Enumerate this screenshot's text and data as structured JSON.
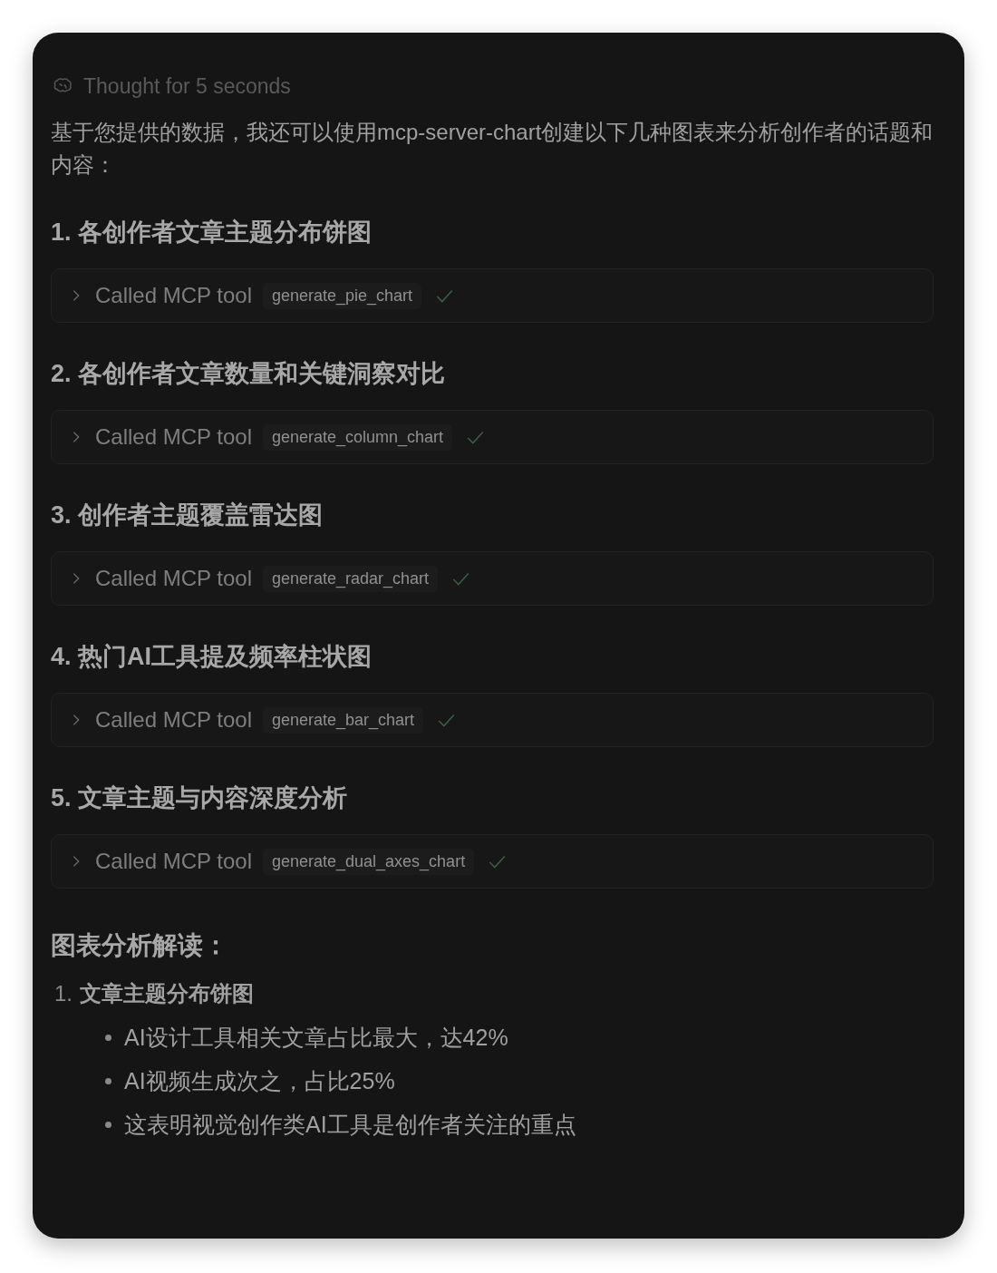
{
  "thought": {
    "label": "Thought for 5 seconds"
  },
  "intro": "基于您提供的数据，我还可以使用mcp-server-chart创建以下几种图表来分析创作者的话题和内容：",
  "sections": [
    {
      "heading": "1. 各创作者文章主题分布饼图",
      "tool_call": {
        "label": "Called MCP tool",
        "tool": "generate_pie_chart",
        "expanded": false,
        "done": true
      }
    },
    {
      "heading": "2. 各创作者文章数量和关键洞察对比",
      "tool_call": {
        "label": "Called MCP tool",
        "tool": "generate_column_chart",
        "expanded": false,
        "done": true
      }
    },
    {
      "heading": "3. 创作者主题覆盖雷达图",
      "tool_call": {
        "label": "Called MCP tool",
        "tool": "generate_radar_chart",
        "expanded": false,
        "done": true
      }
    },
    {
      "heading": "4. 热门AI工具提及频率柱状图",
      "tool_call": {
        "label": "Called MCP tool",
        "tool": "generate_bar_chart",
        "expanded": false,
        "done": true
      }
    },
    {
      "heading": "5. 文章主题与内容深度分析",
      "tool_call": {
        "label": "Called MCP tool",
        "tool": "generate_dual_axes_chart",
        "expanded": false,
        "done": true
      }
    }
  ],
  "analysis": {
    "heading": "图表分析解读：",
    "items": [
      {
        "number": "1.",
        "title": "文章主题分布饼图",
        "bullets": [
          "AI设计工具相关文章占比最大，达42%",
          "AI视频生成次之，占比25%",
          "这表明视觉创作类AI工具是创作者关注的重点"
        ]
      }
    ]
  }
}
